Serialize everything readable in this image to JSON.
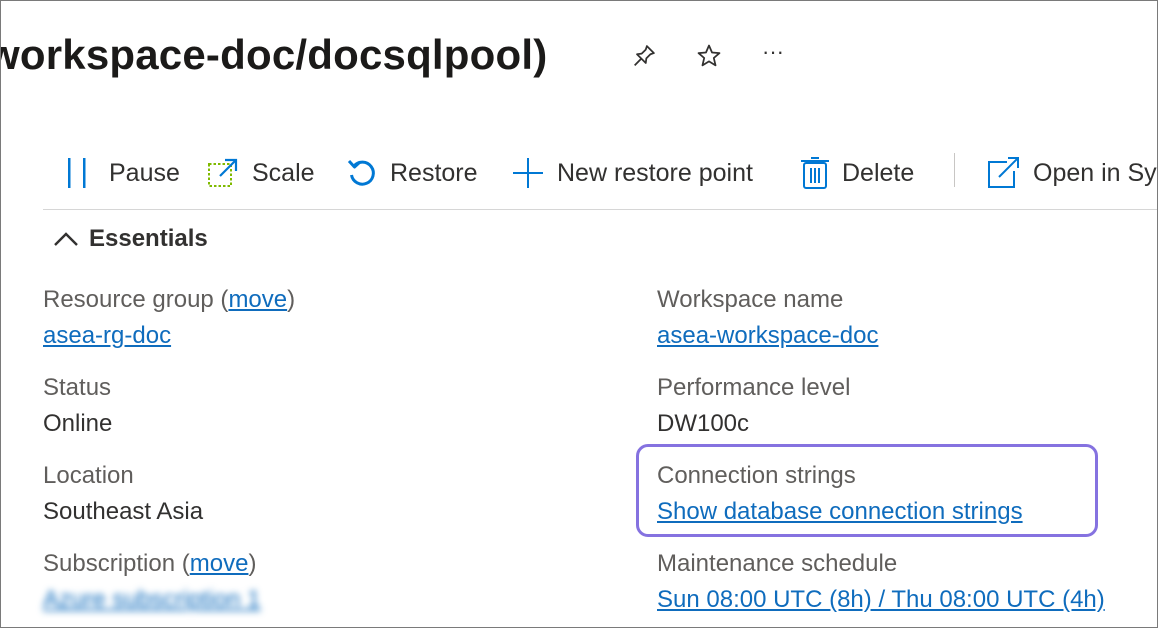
{
  "header": {
    "title": "workspace-doc/docsqlpool)",
    "more_glyph": "···"
  },
  "toolbar": {
    "pause": "Pause",
    "scale": "Scale",
    "restore": "Restore",
    "new_restore_point": "New restore point",
    "delete": "Delete",
    "open_in": "Open in Sy"
  },
  "essentials": {
    "heading": "Essentials",
    "resource_group": {
      "label": "Resource group",
      "move_link": "move",
      "value": "asea-rg-doc"
    },
    "status": {
      "label": "Status",
      "value": "Online"
    },
    "location": {
      "label": "Location",
      "value": "Southeast Asia"
    },
    "subscription": {
      "label": "Subscription",
      "move_link": "move",
      "value": "Azure subscription 1"
    },
    "workspace_name": {
      "label": "Workspace name",
      "value": "asea-workspace-doc"
    },
    "performance_level": {
      "label": "Performance level",
      "value": "DW100c"
    },
    "connection_strings": {
      "label": "Connection strings",
      "value": "Show database connection strings"
    },
    "maintenance_schedule": {
      "label": "Maintenance schedule",
      "value": "Sun 08:00 UTC (8h) / Thu 08:00 UTC (4h)"
    }
  },
  "colors": {
    "link": "#0f6cbd",
    "accent": "#0078d4",
    "highlight": "#8572e0"
  }
}
